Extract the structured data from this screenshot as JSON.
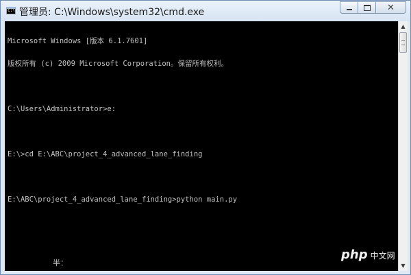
{
  "window": {
    "title": "管理员: C:\\Windows\\system32\\cmd.exe",
    "icon": "cmd-console-icon",
    "icon_text": "C:\\"
  },
  "caption_buttons": {
    "minimize_icon": "minimize-icon",
    "maximize_icon": "maximize-icon",
    "close_label": "✕"
  },
  "console": {
    "background": "#000000",
    "text_color": "#c0c0c0",
    "lines": [
      "Microsoft Windows [版本 6.1.7601]",
      "版权所有 (c) 2009 Microsoft Corporation。保留所有权利。",
      "",
      "C:\\Users\\Administrator>e:",
      "",
      "E:\\>cd E:\\ABC\\project_4_advanced_lane_finding",
      "",
      "E:\\ABC\\project_4_advanced_lane_finding>python main.py"
    ],
    "ime_status": "半："
  },
  "scrollbar": {
    "up_arrow": "▲",
    "down_arrow": "▼"
  },
  "watermark": {
    "logo": "php",
    "text": "中文网"
  }
}
